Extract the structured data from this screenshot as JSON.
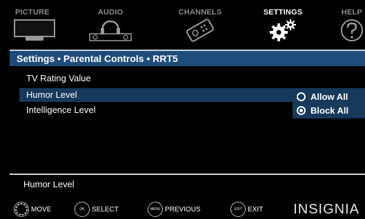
{
  "tabs": [
    {
      "label": "PICTURE",
      "icon": "tv-icon",
      "active": false
    },
    {
      "label": "AUDIO",
      "icon": "headphones-icon",
      "active": false
    },
    {
      "label": "CHANNELS",
      "icon": "satellite-icon",
      "active": false
    },
    {
      "label": "SETTINGS",
      "icon": "gears-icon",
      "active": true
    },
    {
      "label": "HELP",
      "icon": "help-icon",
      "active": false
    }
  ],
  "breadcrumb": "Settings • Parental Controls • RRT5",
  "section_heading": "TV Rating Value",
  "rows": [
    {
      "label": "Humor Level",
      "selected": true
    },
    {
      "label": "Intelligence Level",
      "selected": false
    }
  ],
  "options": [
    {
      "label": "Allow All",
      "checked": false
    },
    {
      "label": "Block All",
      "checked": true
    }
  ],
  "help_text": "Humor Level",
  "hints": [
    {
      "button": "",
      "label": "MOVE",
      "icon": "dpad-icon"
    },
    {
      "button": "OK",
      "label": "SELECT",
      "icon": "ok-button-icon"
    },
    {
      "button": "MENU",
      "label": "PREVIOUS",
      "icon": "menu-button-icon"
    },
    {
      "button": "EXIT",
      "label": "EXIT",
      "icon": "exit-button-icon"
    }
  ],
  "logo": "INSIGNIA",
  "colors": {
    "breadcrumb_bg": "#1f4c7a",
    "selection_bg": "#17395c",
    "active_tab": "#ffffff",
    "inactive_tab": "#8a8a8a"
  }
}
